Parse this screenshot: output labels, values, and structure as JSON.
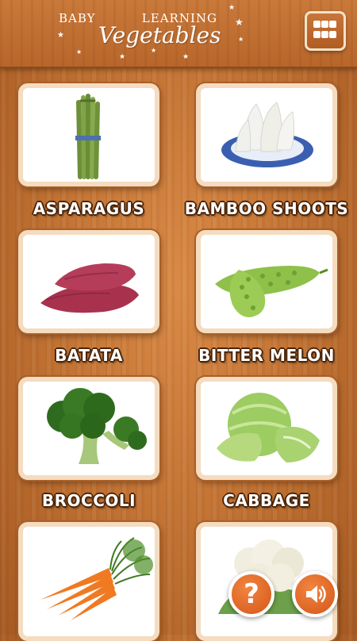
{
  "header": {
    "title_word1": "BABY",
    "title_word2": "LEARNING",
    "title_main": "Vegetables",
    "menu_icon": "grid-menu-icon"
  },
  "items": [
    {
      "label": "ASPARAGUS",
      "icon": "asparagus-image"
    },
    {
      "label": "BAMBOO SHOOTS",
      "icon": "bamboo-shoots-image"
    },
    {
      "label": "BATATA",
      "icon": "sweet-potato-image"
    },
    {
      "label": "BITTER MELON",
      "icon": "bitter-melon-image"
    },
    {
      "label": "BROCCOLI",
      "icon": "broccoli-image"
    },
    {
      "label": "CABBAGE",
      "icon": "cabbage-image"
    },
    {
      "label": "",
      "icon": "carrot-image"
    },
    {
      "label": "",
      "icon": "cauliflower-image"
    }
  ],
  "buttons": {
    "help_icon": "question-mark-icon",
    "help_label": "?",
    "sound_icon": "speaker-icon"
  },
  "colors": {
    "wood": "#c47535",
    "card_border": "#f5dcc0",
    "button_orange": "#d4561a"
  }
}
